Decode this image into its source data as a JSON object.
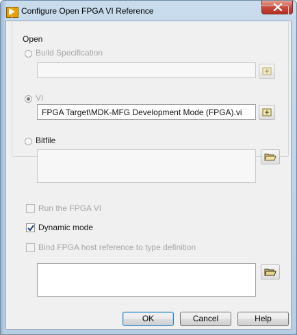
{
  "window": {
    "title": "Configure Open FPGA VI Reference"
  },
  "open_group": {
    "legend": "Open",
    "build_specification": {
      "label": "Build Specification",
      "value": ""
    },
    "vi": {
      "label": "VI",
      "value": "FPGA Target\\MDK-MFG Development Mode (FPGA).vi"
    },
    "bitfile": {
      "label": "Bitfile",
      "value": ""
    }
  },
  "options": {
    "run_fpga_vi": {
      "label": "Run the FPGA VI",
      "checked": false,
      "enabled": false
    },
    "dynamic_mode": {
      "label": "Dynamic mode",
      "checked": true,
      "enabled": true
    },
    "bind_type_def": {
      "label": "Bind FPGA host reference to type definition",
      "checked": false,
      "enabled": false
    },
    "type_definition": {
      "value": ""
    }
  },
  "buttons": {
    "ok": "OK",
    "cancel": "Cancel",
    "help": "Help"
  },
  "icons": {
    "app": "labview-arrow-icon",
    "close": "close-icon",
    "browse_file": "browse-file-icon",
    "browse_folder": "folder-open-icon"
  }
}
